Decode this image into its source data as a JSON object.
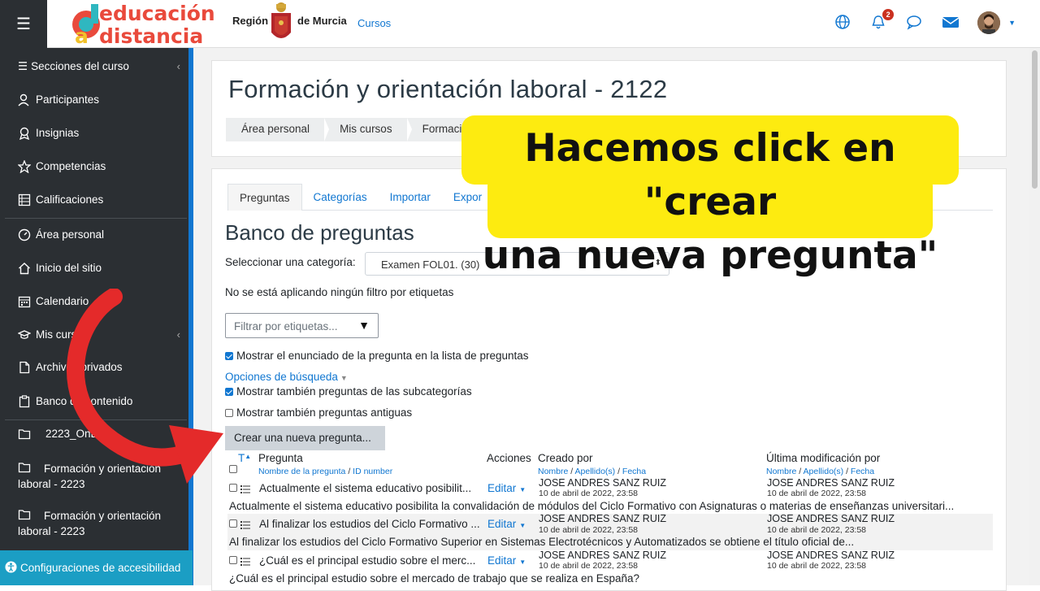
{
  "header": {
    "logo_line1": "educación",
    "logo_line2": "a distancia",
    "region_left": "Región",
    "region_right": "de Murcia",
    "cursos_link": "Cursos",
    "notification_count": "2"
  },
  "sidebar": {
    "items": [
      {
        "label": "Secciones del curso",
        "icon": "list-icon"
      },
      {
        "label": "Participantes",
        "icon": "users-icon"
      },
      {
        "label": "Insignias",
        "icon": "badge-icon"
      },
      {
        "label": "Competencias",
        "icon": "star-icon"
      },
      {
        "label": "Calificaciones",
        "icon": "table-icon"
      },
      {
        "label": "Área personal",
        "icon": "dashboard-icon"
      },
      {
        "label": "Inicio del sitio",
        "icon": "home-icon"
      },
      {
        "label": "Calendario",
        "icon": "calendar-icon"
      },
      {
        "label": "Mis cursos",
        "icon": "graduation-cap-icon"
      },
      {
        "label": "Archivos privados",
        "icon": "file-icon"
      },
      {
        "label": "Banco de contenido",
        "icon": "paste-icon"
      },
      {
        "label": "2223_OnLine_",
        "icon": "folder-icon"
      },
      {
        "label": "Formación y orientación laboral - 2223",
        "icon": "folder-icon"
      },
      {
        "label": "Formación y orientación laboral - 2223",
        "icon": "folder-icon"
      }
    ],
    "accessibility": "Configuraciones de accesibilidad"
  },
  "page": {
    "title": "Formación y orientación laboral - 2122",
    "breadcrumb": [
      "Área personal",
      "Mis cursos",
      "Formació"
    ]
  },
  "tabs": [
    "Preguntas",
    "Categorías",
    "Importar",
    "Expor"
  ],
  "bank": {
    "heading": "Banco de preguntas",
    "category_label": "Seleccionar una categoría:",
    "category_value": "Examen FOL01. (30)",
    "no_filter": "No se está aplicando ningún filtro por etiquetas",
    "filter_placeholder": "Filtrar por etiquetas...",
    "show_text": "Mostrar el enunciado de la pregunta en la lista de preguntas",
    "search_options": "Opciones de búsqueda",
    "show_subcats": "Mostrar también preguntas de las subcategorías",
    "show_old": "Mostrar también preguntas antiguas",
    "create_button": "Crear una nueva pregunta..."
  },
  "table": {
    "col_t": "T",
    "col_question": "Pregunta",
    "col_question_sub1": "Nombre de la pregunta",
    "col_question_sub2": "ID number",
    "col_actions": "Acciones",
    "col_created": "Creado por",
    "col_modified": "Última modificación por",
    "sub_name": "Nombre",
    "sub_surname": "Apellido(s)",
    "sub_date": "Fecha",
    "edit_label": "Editar",
    "rows": [
      {
        "name": "Actualmente el sistema educativo posibilit...",
        "author": "JOSE ANDRES SANZ RUIZ",
        "date": "10 de abril de 2022, 23:58",
        "mod_author": "JOSE ANDRES SANZ RUIZ",
        "mod_date": "10 de abril de 2022, 23:58",
        "text": "Actualmente el sistema educativo posibilita la convalidación de módulos del Ciclo Formativo con Asignaturas o materias de enseñanzas universitari..."
      },
      {
        "name": "Al finalizar los estudios del Ciclo Formativo ...",
        "author": "JOSE ANDRES SANZ RUIZ",
        "date": "10 de abril de 2022, 23:58",
        "mod_author": "JOSE ANDRES SANZ RUIZ",
        "mod_date": "10 de abril de 2022, 23:58",
        "text": "Al finalizar los estudios del Ciclo Formativo Superior en Sistemas Electrotécnicos y Automatizados se obtiene el título oficial de..."
      },
      {
        "name": "¿Cuál es el principal estudio sobre el merc...",
        "author": "JOSE ANDRES SANZ RUIZ",
        "date": "10 de abril de 2022, 23:58",
        "mod_author": "JOSE ANDRES SANZ RUIZ",
        "mod_date": "10 de abril de 2022, 23:58",
        "text": "¿Cuál es el principal estudio sobre el mercado de trabajo que se realiza en España?"
      }
    ]
  },
  "overlay": {
    "callout_line1": "Hacemos click en \"crear",
    "callout_line2": "una nueva pregunta\""
  },
  "colors": {
    "sidebar_bg": "#2b2f33",
    "link_blue": "#1177d1",
    "callout_yellow": "#fdeb10",
    "arrow_red": "#e42a2a",
    "accessibility_bg": "#1b9ec4"
  }
}
